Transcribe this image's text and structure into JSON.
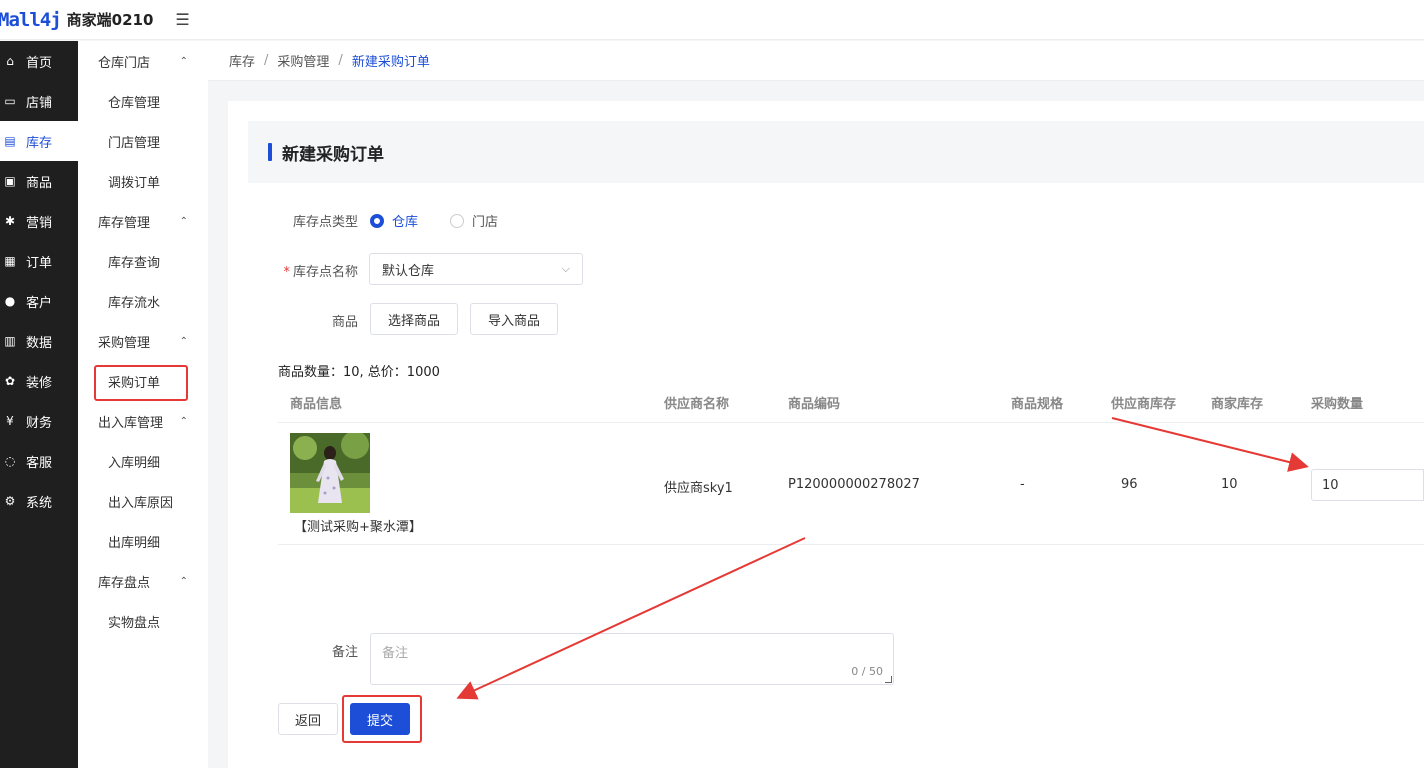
{
  "header": {
    "logo": "Mall4j",
    "shop_name": "商家端0210",
    "collapse_icon": "☰"
  },
  "nav1": [
    {
      "icon": "⌂",
      "label": "首页"
    },
    {
      "icon": "▭",
      "label": "店铺"
    },
    {
      "icon": "▤",
      "label": "库存"
    },
    {
      "icon": "▣",
      "label": "商品"
    },
    {
      "icon": "✱",
      "label": "营销"
    },
    {
      "icon": "▦",
      "label": "订单"
    },
    {
      "icon": "●",
      "label": "客户"
    },
    {
      "icon": "▥",
      "label": "数据"
    },
    {
      "icon": "✿",
      "label": "装修"
    },
    {
      "icon": "¥",
      "label": "财务"
    },
    {
      "icon": "◌",
      "label": "客服"
    },
    {
      "icon": "⚙",
      "label": "系统"
    }
  ],
  "nav2": {
    "group1": "仓库门店",
    "g1_items": [
      "仓库管理",
      "门店管理",
      "调拨订单"
    ],
    "group2": "库存管理",
    "g2_items": [
      "库存查询",
      "库存流水"
    ],
    "group3": "采购管理",
    "g3_items": [
      "采购订单"
    ],
    "group4": "出入库管理",
    "g4_items": [
      "入库明细",
      "出入库原因",
      "出库明细"
    ],
    "group5": "库存盘点",
    "g5_items": [
      "实物盘点"
    ],
    "chevron": "⌃"
  },
  "breadcrumb": {
    "c1": "库存",
    "c2": "采购管理",
    "c3": "新建采购订单",
    "sep": "/"
  },
  "page": {
    "title": "新建采购订单"
  },
  "form": {
    "type_label": "库存点类型",
    "type_opt1": "仓库",
    "type_opt2": "门店",
    "name_label": "库存点名称",
    "required_mark": "*",
    "name_value": "默认仓库",
    "goods_label": "商品",
    "select_goods": "选择商品",
    "import_goods": "导入商品",
    "summary": "商品数量：10, 总价：1000",
    "remark_label": "备注",
    "remark_placeholder": "备注",
    "remark_count": "0 / 50",
    "back": "返回",
    "submit": "提交"
  },
  "table": {
    "headers": [
      "商品信息",
      "供应商名称",
      "商品编码",
      "商品规格",
      "供应商库存",
      "商家库存",
      "采购数量"
    ],
    "row": {
      "name": "【测试采购+聚水潭】",
      "supplier": "供应商sky1",
      "code": "P120000000278027",
      "spec": "-",
      "supplier_stock": "96",
      "merchant_stock": "10",
      "qty": "10"
    }
  },
  "colors": {
    "accent": "#1d4ed8",
    "annotation": "#e53935",
    "sidebar": "#1f1f1f"
  }
}
